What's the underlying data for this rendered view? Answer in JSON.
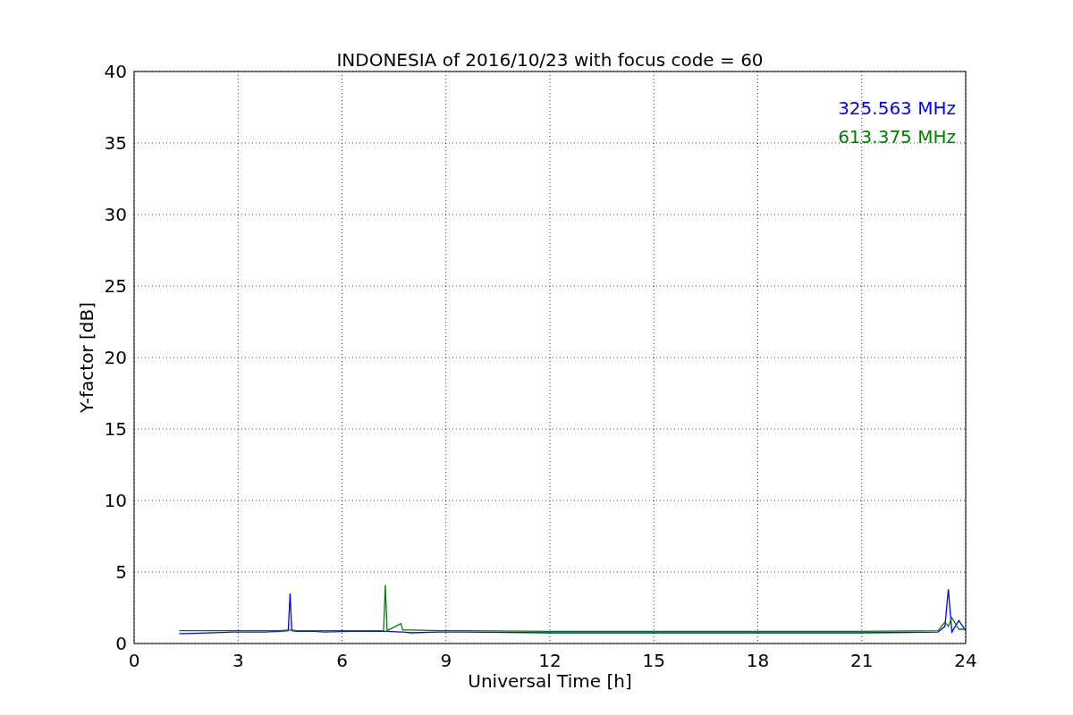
{
  "figure": {
    "chart_data": {
      "type": "line",
      "title": "INDONESIA of 2016/10/23 with focus code = 60",
      "xlabel": "Universal Time [h]",
      "ylabel": "Y-factor [dB]",
      "xlim": [
        0,
        24
      ],
      "ylim": [
        0,
        40
      ],
      "xticks": [
        0,
        3,
        6,
        9,
        12,
        15,
        18,
        21,
        24
      ],
      "yticks": [
        0,
        5,
        10,
        15,
        20,
        25,
        30,
        35,
        40
      ],
      "grid": true,
      "x": [
        1.3,
        1.5,
        2.8,
        3.2,
        3.8,
        4.2,
        4.45,
        4.5,
        4.55,
        4.7,
        5.0,
        5.2,
        5.5,
        6.2,
        6.8,
        7.2,
        7.25,
        7.3,
        7.7,
        7.75,
        8.0,
        8.8,
        9.5,
        12,
        15,
        18,
        21,
        23.2,
        23.4,
        23.5,
        23.6,
        23.8,
        24
      ],
      "series": [
        {
          "name": "325.563 MHz",
          "color": "#0000ff",
          "values": [
            0.7,
            0.7,
            0.8,
            0.8,
            0.8,
            0.85,
            0.9,
            3.5,
            0.9,
            0.85,
            0.85,
            0.85,
            0.8,
            0.85,
            0.85,
            0.85,
            0.85,
            0.85,
            0.8,
            0.8,
            0.75,
            0.8,
            0.8,
            0.75,
            0.75,
            0.75,
            0.75,
            0.8,
            1.2,
            3.8,
            0.8,
            1.6,
            0.9
          ]
        },
        {
          "name": "613.375 MHz",
          "color": "#008000",
          "values": [
            0.9,
            0.9,
            0.9,
            0.9,
            0.9,
            0.9,
            0.95,
            0.95,
            0.95,
            0.9,
            0.9,
            0.9,
            0.9,
            0.9,
            0.9,
            0.9,
            4.1,
            0.9,
            1.4,
            0.95,
            0.95,
            0.9,
            0.9,
            0.85,
            0.85,
            0.85,
            0.85,
            0.9,
            1.5,
            1.2,
            1.8,
            1.0,
            1.0
          ]
        }
      ]
    }
  }
}
